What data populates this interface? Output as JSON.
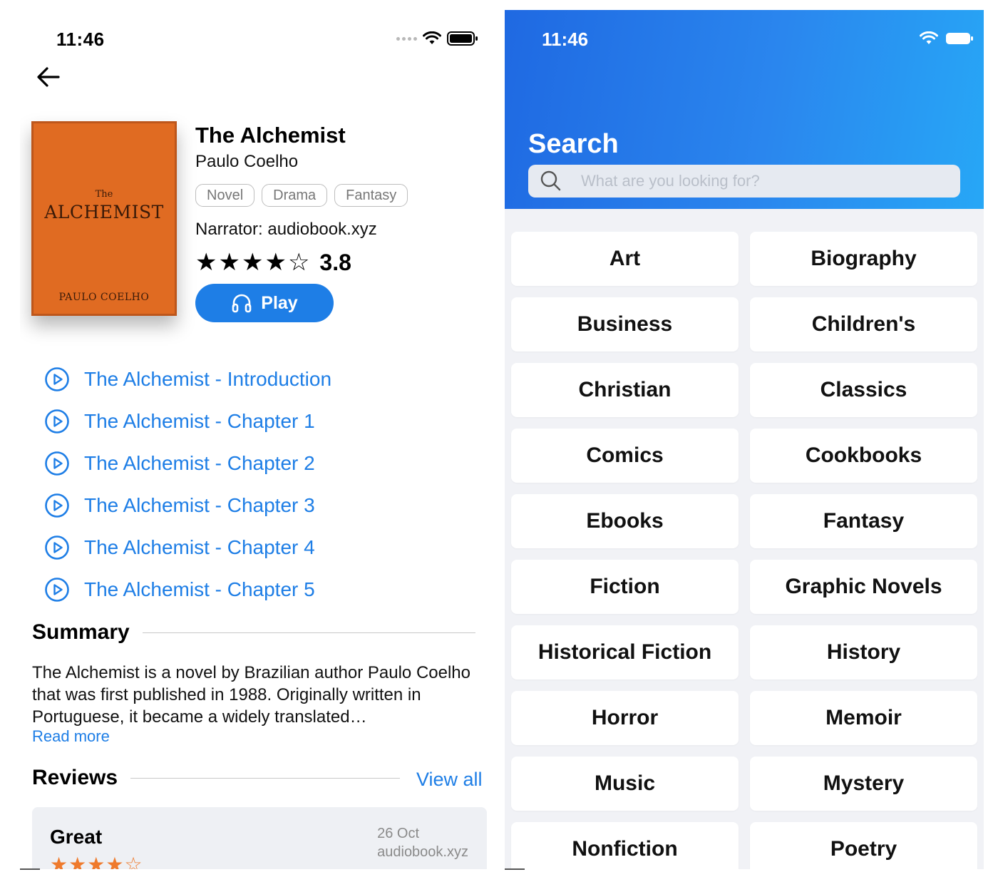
{
  "left_screen": {
    "status_time": "11:46",
    "book": {
      "cover_the": "The",
      "cover_title": "ALCHEMIST",
      "cover_author": "PAULO COELHO",
      "title": "The Alchemist",
      "author": "Paulo Coelho",
      "tags": [
        "Novel",
        "Drama",
        "Fantasy"
      ],
      "narrator": "Narrator: audiobook.xyz",
      "rating": "3.8",
      "rating_stars_filled": 4,
      "rating_stars_total": 5,
      "play_label": "Play"
    },
    "chapters": [
      "The Alchemist - Introduction",
      "The Alchemist - Chapter 1",
      "The Alchemist - Chapter 2",
      "The Alchemist - Chapter 3",
      "The Alchemist - Chapter 4",
      "The Alchemist - Chapter 5"
    ],
    "summary": {
      "heading": "Summary",
      "text": "The Alchemist is a novel by Brazilian author Paulo Coelho that was first published in 1988. Originally written in Portuguese, it became a widely translated…",
      "read_more": "Read more"
    },
    "reviews": {
      "heading": "Reviews",
      "view_all": "View all",
      "items": [
        {
          "title": "Great",
          "date": "26 Oct",
          "source": "audiobook.xyz",
          "stars_filled": 3.5
        }
      ]
    }
  },
  "right_screen": {
    "status_time": "11:46",
    "title": "Search",
    "search_placeholder": "What are you looking for?",
    "categories": [
      "Art",
      "Biography",
      "Business",
      "Children's",
      "Christian",
      "Classics",
      "Comics",
      "Cookbooks",
      "Ebooks",
      "Fantasy",
      "Fiction",
      "Graphic Novels",
      "Historical Fiction",
      "History",
      "Horror",
      "Memoir",
      "Music",
      "Mystery",
      "Nonfiction",
      "Poetry"
    ]
  },
  "colors": {
    "accent_blue": "#1e7ee6",
    "cover_orange": "#e06b22",
    "review_star_orange": "#ef7a2c",
    "header_gradient_start": "#1f69e2",
    "header_gradient_end": "#27a7f6"
  }
}
